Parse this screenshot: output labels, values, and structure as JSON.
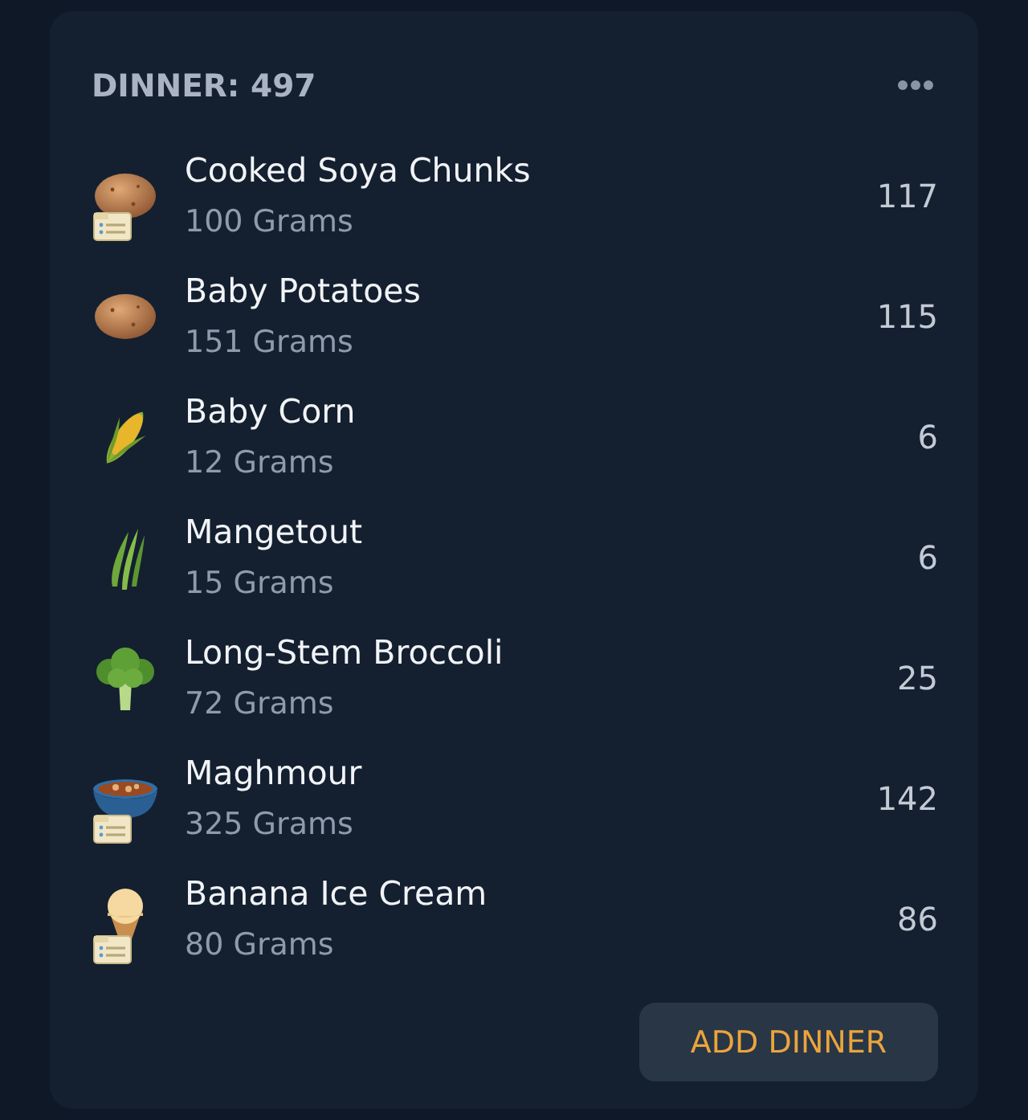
{
  "meal": {
    "title": "DINNER: 497",
    "items": [
      {
        "name": "Cooked Soya Chunks",
        "amount": "100 Grams",
        "calories": "117",
        "kind": "potato",
        "recipe_badge": true
      },
      {
        "name": "Baby Potatoes",
        "amount": "151 Grams",
        "calories": "115",
        "kind": "potato",
        "recipe_badge": false
      },
      {
        "name": "Baby Corn",
        "amount": "12 Grams",
        "calories": "6",
        "kind": "corn",
        "recipe_badge": false
      },
      {
        "name": "Mangetout",
        "amount": "15 Grams",
        "calories": "6",
        "kind": "beans",
        "recipe_badge": false
      },
      {
        "name": "Long-Stem Broccoli",
        "amount": "72 Grams",
        "calories": "25",
        "kind": "broccoli",
        "recipe_badge": false
      },
      {
        "name": "Maghmour",
        "amount": "325 Grams",
        "calories": "142",
        "kind": "bowl",
        "recipe_badge": true
      },
      {
        "name": "Banana Ice Cream",
        "amount": "80 Grams",
        "calories": "86",
        "kind": "ice-cream",
        "recipe_badge": true
      }
    ],
    "add_button": "ADD DINNER"
  }
}
